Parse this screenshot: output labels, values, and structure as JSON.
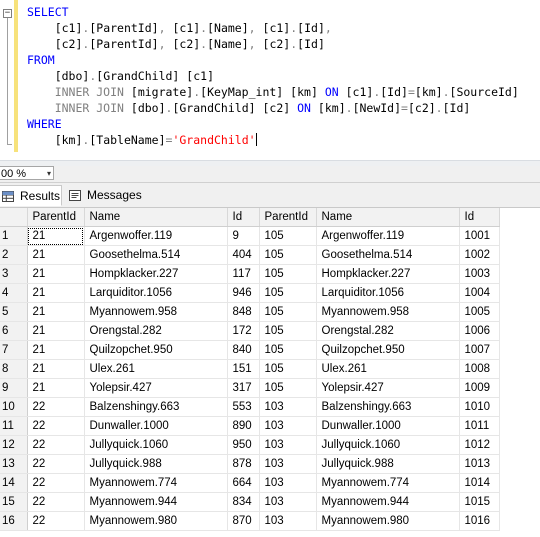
{
  "editor": {
    "lines": [
      [
        {
          "t": "SELECT",
          "c": "kw"
        }
      ],
      [
        {
          "t": "    "
        },
        {
          "t": "[c1]"
        },
        {
          "t": ".",
          "c": "gr"
        },
        {
          "t": "[ParentId]"
        },
        {
          "t": ",",
          "c": "gr"
        },
        {
          "t": " "
        },
        {
          "t": "[c1]"
        },
        {
          "t": ".",
          "c": "gr"
        },
        {
          "t": "[Name]"
        },
        {
          "t": ",",
          "c": "gr"
        },
        {
          "t": " "
        },
        {
          "t": "[c1]"
        },
        {
          "t": ".",
          "c": "gr"
        },
        {
          "t": "[Id]"
        },
        {
          "t": ",",
          "c": "gr"
        }
      ],
      [
        {
          "t": "    "
        },
        {
          "t": "[c2]"
        },
        {
          "t": ".",
          "c": "gr"
        },
        {
          "t": "[ParentId]"
        },
        {
          "t": ",",
          "c": "gr"
        },
        {
          "t": " "
        },
        {
          "t": "[c2]"
        },
        {
          "t": ".",
          "c": "gr"
        },
        {
          "t": "[Name]"
        },
        {
          "t": ",",
          "c": "gr"
        },
        {
          "t": " "
        },
        {
          "t": "[c2]"
        },
        {
          "t": ".",
          "c": "gr"
        },
        {
          "t": "[Id]"
        }
      ],
      [
        {
          "t": "FROM",
          "c": "kw"
        }
      ],
      [
        {
          "t": "    "
        },
        {
          "t": "[dbo]"
        },
        {
          "t": ".",
          "c": "gr"
        },
        {
          "t": "[GrandChild]"
        },
        {
          "t": " "
        },
        {
          "t": "[c1]"
        }
      ],
      [
        {
          "t": "    "
        },
        {
          "t": "INNER JOIN",
          "c": "gr"
        },
        {
          "t": " "
        },
        {
          "t": "[migrate]"
        },
        {
          "t": ".",
          "c": "gr"
        },
        {
          "t": "[KeyMap_int]"
        },
        {
          "t": " "
        },
        {
          "t": "[km]"
        },
        {
          "t": " "
        },
        {
          "t": "ON",
          "c": "kw"
        },
        {
          "t": " "
        },
        {
          "t": "[c1]"
        },
        {
          "t": ".",
          "c": "gr"
        },
        {
          "t": "[Id]"
        },
        {
          "t": "=",
          "c": "gr"
        },
        {
          "t": "[km]"
        },
        {
          "t": ".",
          "c": "gr"
        },
        {
          "t": "[SourceId]"
        }
      ],
      [
        {
          "t": "    "
        },
        {
          "t": "INNER JOIN",
          "c": "gr"
        },
        {
          "t": " "
        },
        {
          "t": "[dbo]"
        },
        {
          "t": ".",
          "c": "gr"
        },
        {
          "t": "[GrandChild]"
        },
        {
          "t": " "
        },
        {
          "t": "[c2]"
        },
        {
          "t": " "
        },
        {
          "t": "ON",
          "c": "kw"
        },
        {
          "t": " "
        },
        {
          "t": "[km]"
        },
        {
          "t": ".",
          "c": "gr"
        },
        {
          "t": "[NewId]"
        },
        {
          "t": "=",
          "c": "gr"
        },
        {
          "t": "[c2]"
        },
        {
          "t": ".",
          "c": "gr"
        },
        {
          "t": "[Id]"
        }
      ],
      [
        {
          "t": "WHERE",
          "c": "kw"
        }
      ],
      [
        {
          "t": "    "
        },
        {
          "t": "[km]"
        },
        {
          "t": ".",
          "c": "gr"
        },
        {
          "t": "[TableName]"
        },
        {
          "t": "=",
          "c": "gr"
        },
        {
          "t": "'GrandChild'",
          "c": "str"
        }
      ]
    ],
    "collapse_glyph": "−"
  },
  "zoom": {
    "value": "00 %",
    "arrow": "▾"
  },
  "tabs": [
    {
      "label": "Results",
      "icon": "results-grid-icon",
      "active": true
    },
    {
      "label": "Messages",
      "icon": "messages-icon",
      "active": false
    }
  ],
  "grid": {
    "columns": [
      "ParentId",
      "Name",
      "Id",
      "ParentId",
      "Name",
      "Id"
    ],
    "rows": [
      [
        "1",
        "21",
        "Argenwoffer.119",
        "9",
        "105",
        "Argenwoffer.119",
        "1001"
      ],
      [
        "2",
        "21",
        "Goosethelma.514",
        "404",
        "105",
        "Goosethelma.514",
        "1002"
      ],
      [
        "3",
        "21",
        "Hompklacker.227",
        "117",
        "105",
        "Hompklacker.227",
        "1003"
      ],
      [
        "4",
        "21",
        "Larquiditor.1056",
        "946",
        "105",
        "Larquiditor.1056",
        "1004"
      ],
      [
        "5",
        "21",
        "Myannowem.958",
        "848",
        "105",
        "Myannowem.958",
        "1005"
      ],
      [
        "6",
        "21",
        "Orengstal.282",
        "172",
        "105",
        "Orengstal.282",
        "1006"
      ],
      [
        "7",
        "21",
        "Quilzopchet.950",
        "840",
        "105",
        "Quilzopchet.950",
        "1007"
      ],
      [
        "8",
        "21",
        "Ulex.261",
        "151",
        "105",
        "Ulex.261",
        "1008"
      ],
      [
        "9",
        "21",
        "Yolepsir.427",
        "317",
        "105",
        "Yolepsir.427",
        "1009"
      ],
      [
        "10",
        "22",
        "Balzenshingy.663",
        "553",
        "103",
        "Balzenshingy.663",
        "1010"
      ],
      [
        "11",
        "22",
        "Dunwaller.1000",
        "890",
        "103",
        "Dunwaller.1000",
        "1011"
      ],
      [
        "12",
        "22",
        "Jullyquick.1060",
        "950",
        "103",
        "Jullyquick.1060",
        "1012"
      ],
      [
        "13",
        "22",
        "Jullyquick.988",
        "878",
        "103",
        "Jullyquick.988",
        "1013"
      ],
      [
        "14",
        "22",
        "Myannowem.774",
        "664",
        "103",
        "Myannowem.774",
        "1014"
      ],
      [
        "15",
        "22",
        "Myannowem.944",
        "834",
        "103",
        "Myannowem.944",
        "1015"
      ],
      [
        "16",
        "22",
        "Myannowem.980",
        "870",
        "103",
        "Myannowem.980",
        "1016"
      ]
    ]
  }
}
